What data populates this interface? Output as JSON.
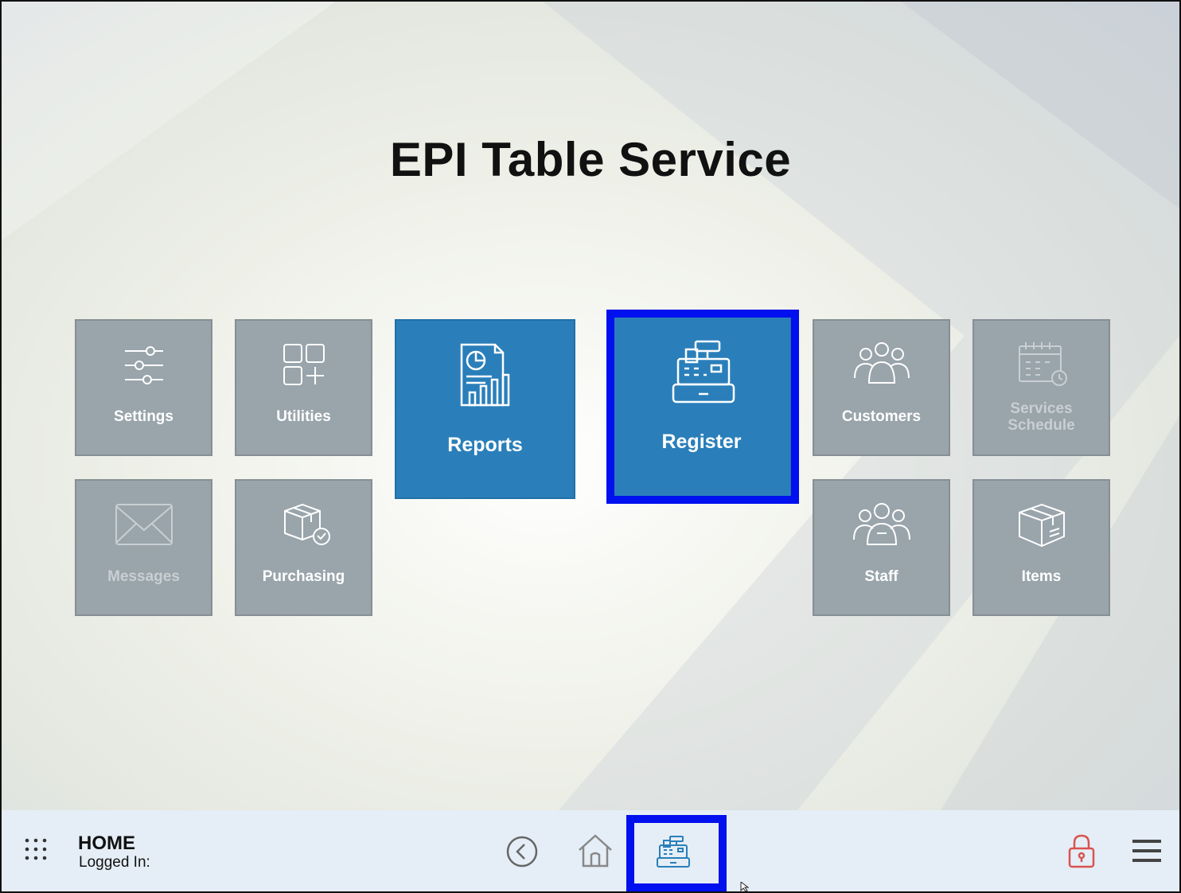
{
  "app": {
    "title": "EPI Table Service"
  },
  "tiles": {
    "settings": {
      "label": "Settings",
      "icon": "sliders-icon"
    },
    "utilities": {
      "label": "Utilities",
      "icon": "grid-plus-icon"
    },
    "reports": {
      "label": "Reports",
      "icon": "report-chart-icon"
    },
    "register": {
      "label": "Register",
      "icon": "cash-register-icon",
      "selected": true
    },
    "customers": {
      "label": "Customers",
      "icon": "group-icon"
    },
    "services_schedule": {
      "label": "Services Schedule",
      "line1": "Services",
      "line2": "Schedule",
      "icon": "calendar-clock-icon"
    },
    "messages": {
      "label": "Messages",
      "icon": "envelope-icon"
    },
    "purchasing": {
      "label": "Purchasing",
      "icon": "box-check-icon"
    },
    "staff": {
      "label": "Staff",
      "icon": "staff-group-icon"
    },
    "items": {
      "label": "Items",
      "icon": "package-icon"
    }
  },
  "bottom_bar": {
    "page_label": "HOME",
    "logged_in_label": "Logged In:",
    "icons": [
      "apps-grid-icon",
      "back-icon",
      "home-icon",
      "cash-register-icon",
      "lock-icon",
      "hamburger-menu-icon"
    ]
  },
  "colors": {
    "tile_gray": "#99a4ab",
    "tile_blue": "#2a7fba",
    "highlight": "#0010ee",
    "lock_red": "#d9534f",
    "bar_bg": "#e5eef6"
  }
}
